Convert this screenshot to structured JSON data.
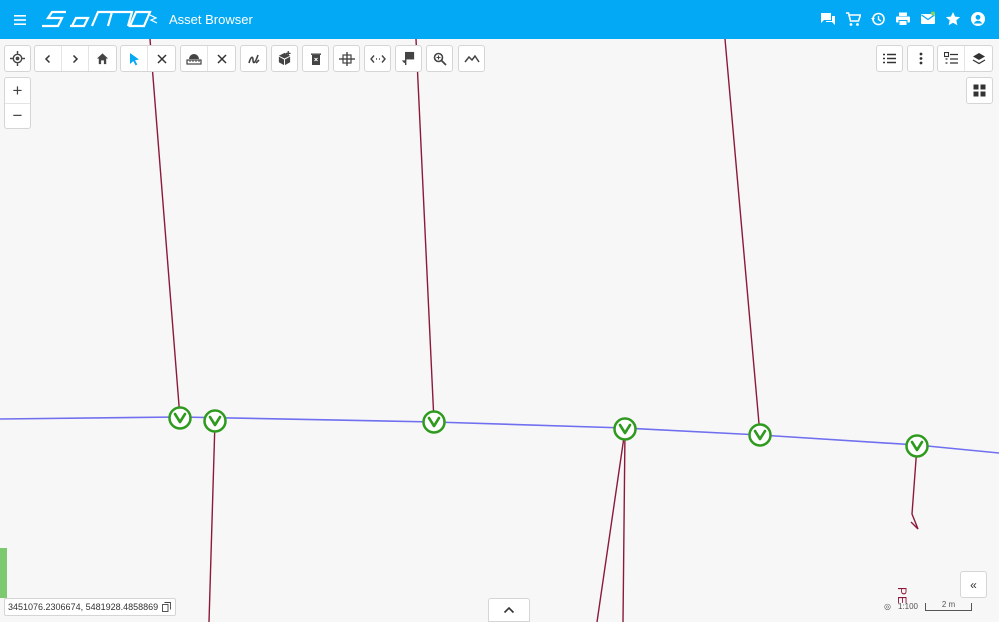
{
  "app": {
    "logo_text": "samo",
    "title": "Asset Browser",
    "theme_color": "#03a9f4"
  },
  "header_actions": [
    {
      "name": "chat-icon"
    },
    {
      "name": "cart-icon"
    },
    {
      "name": "history-icon"
    },
    {
      "name": "print-icon"
    },
    {
      "name": "mail-icon"
    },
    {
      "name": "star-icon"
    },
    {
      "name": "account-icon"
    }
  ],
  "map": {
    "coordinates": "3451076.2306674, 5481928.4858869",
    "scale_label": "1:100",
    "scale_bar_label": "2 m",
    "vertical_label": "PE",
    "zoom_in": "+",
    "zoom_out": "−",
    "side_toggle": "«",
    "colors": {
      "main_line": "#6f6ff0",
      "service_line": "#8b1a3a",
      "valve": "#2e9a1e"
    }
  },
  "toolbar": {
    "left_icons": [
      "locate-icon",
      "back-icon",
      "forward-icon",
      "home-icon",
      "select-icon",
      "clear-selection-icon",
      "measure-icon",
      "clear-measure-icon",
      "draw-icon",
      "add-object-icon",
      "delete-icon",
      "split-icon",
      "distance-icon",
      "flag-icon",
      "zoom-search-icon",
      "profile-icon"
    ],
    "right_icons": [
      "list-icon",
      "more-icon",
      "legend-icon",
      "layers-icon",
      "grid-icon"
    ]
  }
}
